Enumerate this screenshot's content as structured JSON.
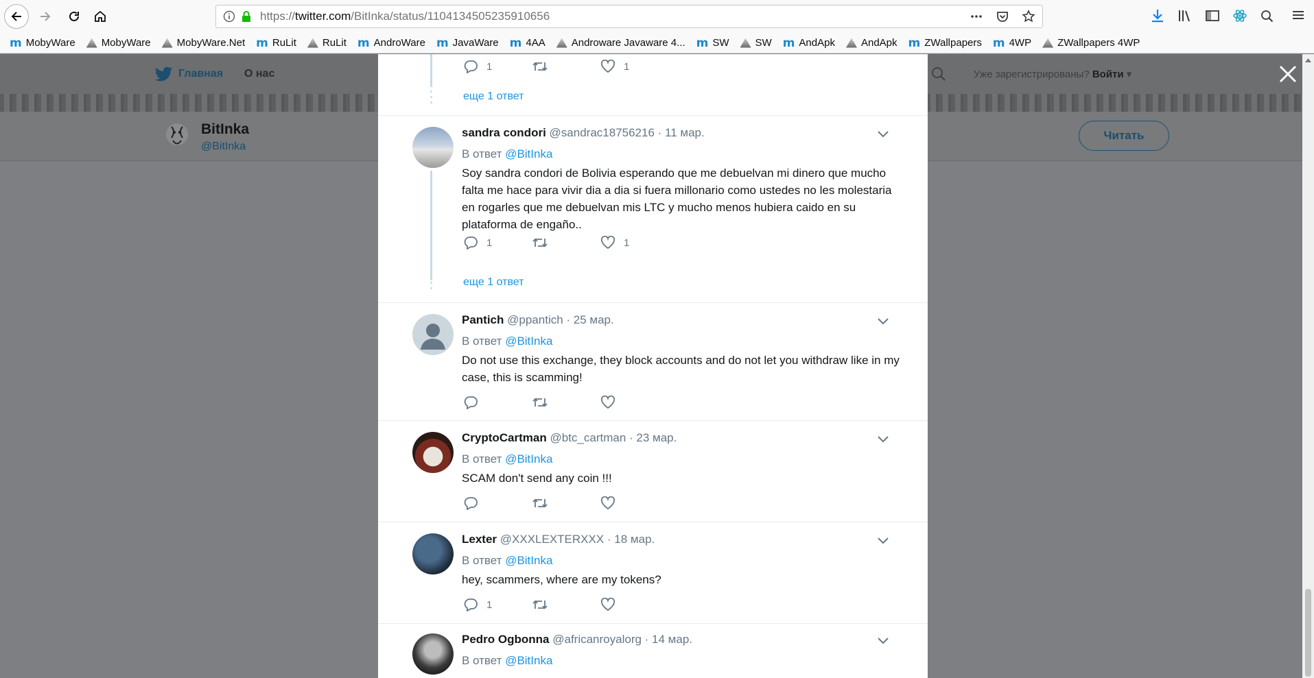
{
  "browser": {
    "url_prefix": "https://",
    "url_domain": "twitter.com",
    "url_path": "/BitInka/status/1104134505235910656",
    "bookmarks": [
      {
        "label": "MobyWare",
        "icon": "m"
      },
      {
        "label": "MobyWare",
        "icon": "img"
      },
      {
        "label": "MobyWare.Net",
        "icon": "img"
      },
      {
        "label": "RuLit",
        "icon": "m"
      },
      {
        "label": "RuLit",
        "icon": "img"
      },
      {
        "label": "AndroWare",
        "icon": "m"
      },
      {
        "label": "JavaWare",
        "icon": "m"
      },
      {
        "label": "4AA",
        "icon": "m"
      },
      {
        "label": "Androware Javaware 4...",
        "icon": "img"
      },
      {
        "label": "SW",
        "icon": "m"
      },
      {
        "label": "SW",
        "icon": "img"
      },
      {
        "label": "AndApk",
        "icon": "m"
      },
      {
        "label": "AndApk",
        "icon": "img"
      },
      {
        "label": "ZWallpapers",
        "icon": "m"
      },
      {
        "label": "4WP",
        "icon": "m"
      },
      {
        "label": "ZWallpapers 4WP",
        "icon": "img"
      }
    ]
  },
  "twitter_nav": {
    "home": "Главная",
    "about": "О нас",
    "login_prompt": "Уже зарегистрированы?",
    "login": "Войти"
  },
  "profile": {
    "name": "BitInka",
    "handle": "@BitInka",
    "follow": "Читать"
  },
  "thread": {
    "top_actions": {
      "replies": "1",
      "likes": "1"
    },
    "more_replies_1": "еще 1 ответ",
    "more_replies_2": "еще 1 ответ"
  },
  "tweets": [
    {
      "name": "sandra condori",
      "meta": "@sandrac18756216 · 11 мар.",
      "reply_prefix": "В ответ",
      "reply_to": "@BitInka",
      "text": "Soy sandra condori de Bolivia  esperando que me debuelvan mi dinero que mucho falta me hace para vivir dia a dia si fuera millonario como ustedes no les molestaria en rogarles que me debuelvan mis LTC y mucho menos hubiera caido en su plataforma de engaño..",
      "replies": "1",
      "likes": "1"
    },
    {
      "name": "Pantich",
      "meta": "@ppantich · 25 мар.",
      "reply_prefix": "В ответ",
      "reply_to": "@BitInka",
      "text": "Do not use this exchange, they block accounts and do not let you withdraw like in my case, this is scamming!",
      "replies": "",
      "likes": ""
    },
    {
      "name": "CryptoCartman",
      "meta": "@btc_cartman · 23 мар.",
      "reply_prefix": "В ответ",
      "reply_to": "@BitInka",
      "text": "SCAM don't send any coin !!!",
      "replies": "",
      "likes": ""
    },
    {
      "name": "Lexter",
      "meta": "@XXXLEXTERXXX · 18 мар.",
      "reply_prefix": "В ответ",
      "reply_to": "@BitInka",
      "text": "hey, scammers, where are my tokens?",
      "replies": "1",
      "likes": ""
    },
    {
      "name": "Pedro Ogbonna",
      "meta": "@africanroyalorg · 14 мар.",
      "reply_prefix": "В ответ",
      "reply_to": "@BitInka",
      "text": "",
      "replies": "",
      "likes": ""
    }
  ],
  "colors": {
    "link": "#1b95e0",
    "meta": "#657786",
    "overlay": "#7d7f82"
  }
}
